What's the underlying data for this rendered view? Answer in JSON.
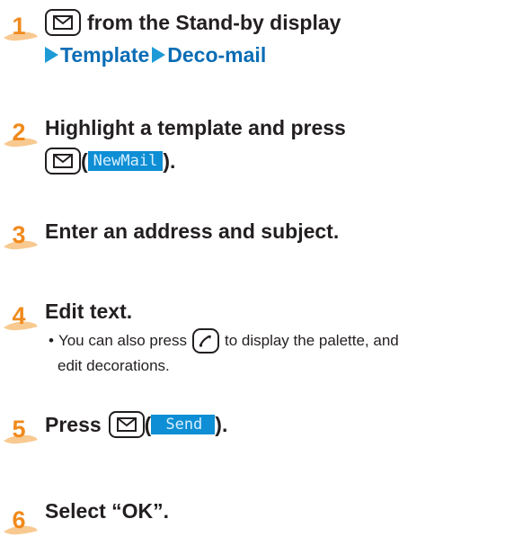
{
  "steps": [
    {
      "number": "1",
      "line1_text": "from the Stand-by display",
      "menu_path": [
        "Template",
        "Deco-mail"
      ]
    },
    {
      "number": "2",
      "line1_text": "Highlight a template and press",
      "open_paren": "(",
      "softkey": "NewMail",
      "close_paren": ")."
    },
    {
      "number": "3",
      "text": "Enter an address and subject."
    },
    {
      "number": "4",
      "text": "Edit text.",
      "note_bullet": "•",
      "note_part1": "You can also press",
      "note_part2": "to display the palette, and",
      "note_line2": "edit decorations."
    },
    {
      "number": "5",
      "text": "Press",
      "open_paren": "(",
      "softkey": "Send",
      "close_paren": ")."
    },
    {
      "number": "6",
      "text": "Select “OK”."
    }
  ],
  "colors": {
    "step_number": "#f08a1c",
    "menu_arrow": "#1e9bd7",
    "menu_text": "#0a6db5",
    "softkey_bg": "#0e8ed4"
  },
  "icons": {
    "mail_key": "mail-key-icon",
    "pen_key": "pen-key-icon",
    "menu_arrow": "triangle-right-icon"
  }
}
